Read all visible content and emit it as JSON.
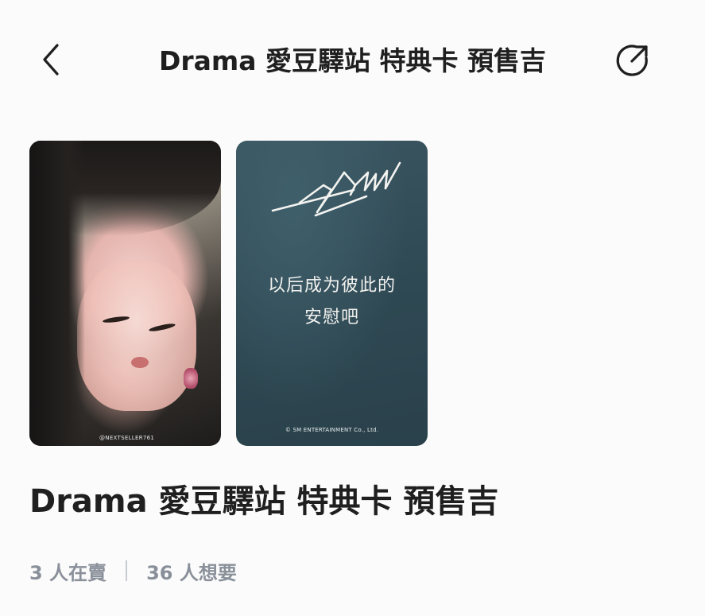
{
  "header": {
    "title": "Drama 愛豆驛站 特典卡 預售吉",
    "back_icon": "chevron-left-icon",
    "share_icon": "share-icon"
  },
  "cards": [
    {
      "kind": "photo-front",
      "caption": "@NEXTSELLER761"
    },
    {
      "kind": "text-back",
      "logo_text": "DRAMA",
      "poem_line1": "以后成为彼此的",
      "poem_line2": "安慰吧",
      "copyright": "© SM ENTERTAINMENT Co., Ltd."
    }
  ],
  "product": {
    "title": "Drama 愛豆驛站 特典卡 預售吉",
    "sellers": "3 人在賣",
    "wants": "36 人想要"
  },
  "colors": {
    "background": "#fbfbfb",
    "text_primary": "#1f1f1f",
    "text_secondary": "#8a909a",
    "card_back": "#2f4954"
  }
}
